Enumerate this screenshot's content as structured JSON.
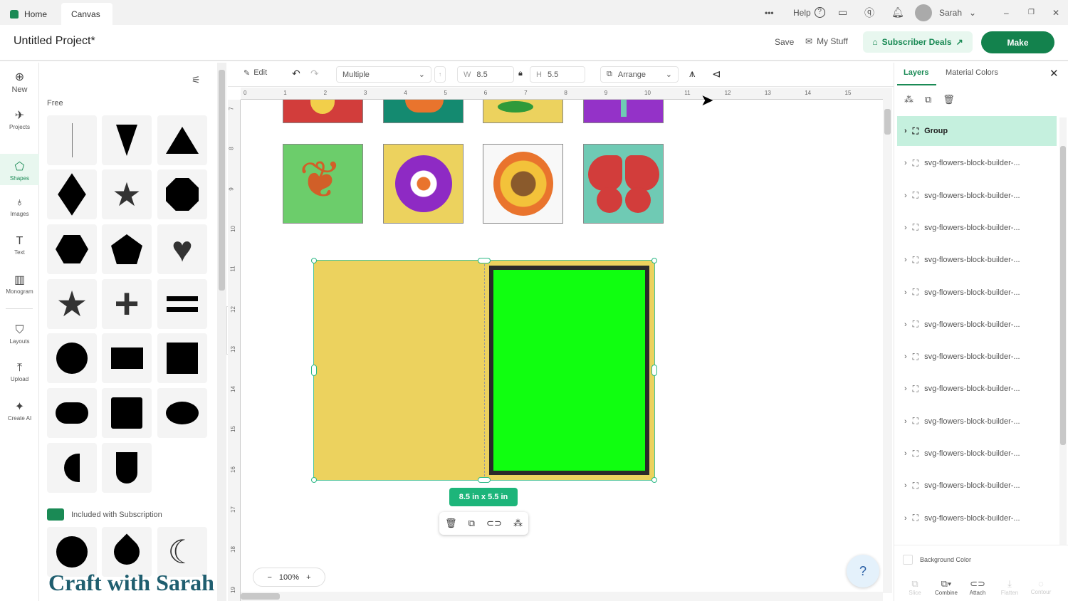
{
  "topbar": {
    "home": "Home",
    "canvas": "Canvas",
    "more": "•••",
    "help": "Help",
    "user": "Sarah"
  },
  "header": {
    "title": "Untitled Project*",
    "save": "Save",
    "my_stuff": "My Stuff",
    "deals": "Subscriber Deals",
    "make": "Make"
  },
  "nav": [
    {
      "label": "New",
      "icon": "plus-circle-icon"
    },
    {
      "label": "Projects",
      "icon": "rocket-icon"
    },
    {
      "label": "Shapes",
      "icon": "shapes-icon"
    },
    {
      "label": "Images",
      "icon": "bulb-icon"
    },
    {
      "label": "Text",
      "icon": "text-icon"
    },
    {
      "label": "Monogram",
      "icon": "monogram-icon"
    },
    {
      "label": "Layouts",
      "icon": "shirt-icon"
    },
    {
      "label": "Upload",
      "icon": "upload-icon"
    },
    {
      "label": "Create AI",
      "icon": "sparkle-icon"
    }
  ],
  "shapes": {
    "free_label": "Free",
    "sub_label": "Included with Subscription",
    "watermark": "Craft with Sarah"
  },
  "toolbar": {
    "edit": "Edit",
    "operation": "Multiple",
    "w_label": "W",
    "w": "8.5",
    "h_label": "H",
    "h": "5.5",
    "arrange": "Arrange"
  },
  "ruler": {
    "h": [
      "0",
      "1",
      "2",
      "3",
      "4",
      "5",
      "6",
      "7",
      "8",
      "9",
      "10",
      "11",
      "12",
      "13",
      "14",
      "15"
    ],
    "v": [
      "7",
      "8",
      "9",
      "10",
      "11",
      "12",
      "13",
      "14",
      "15",
      "16",
      "17",
      "18",
      "19"
    ]
  },
  "canvas": {
    "size_badge": "8.5 in x 5.5 in",
    "zoom": "100%"
  },
  "colors": {
    "accent": "#13824d",
    "yellow": "#ecd25e",
    "green": "#10ff10"
  },
  "right": {
    "tab_layers": "Layers",
    "tab_colors": "Material Colors",
    "layers": [
      "Group",
      "svg-flowers-block-builder-...",
      "svg-flowers-block-builder-...",
      "svg-flowers-block-builder-...",
      "svg-flowers-block-builder-...",
      "svg-flowers-block-builder-...",
      "svg-flowers-block-builder-...",
      "svg-flowers-block-builder-...",
      "svg-flowers-block-builder-...",
      "svg-flowers-block-builder-...",
      "svg-flowers-block-builder-...",
      "svg-flowers-block-builder-...",
      "svg-flowers-block-builder-..."
    ],
    "bg_color": "Background Color",
    "bottom": [
      "Slice",
      "Combine",
      "Attach",
      "Flatten",
      "Contour"
    ]
  }
}
